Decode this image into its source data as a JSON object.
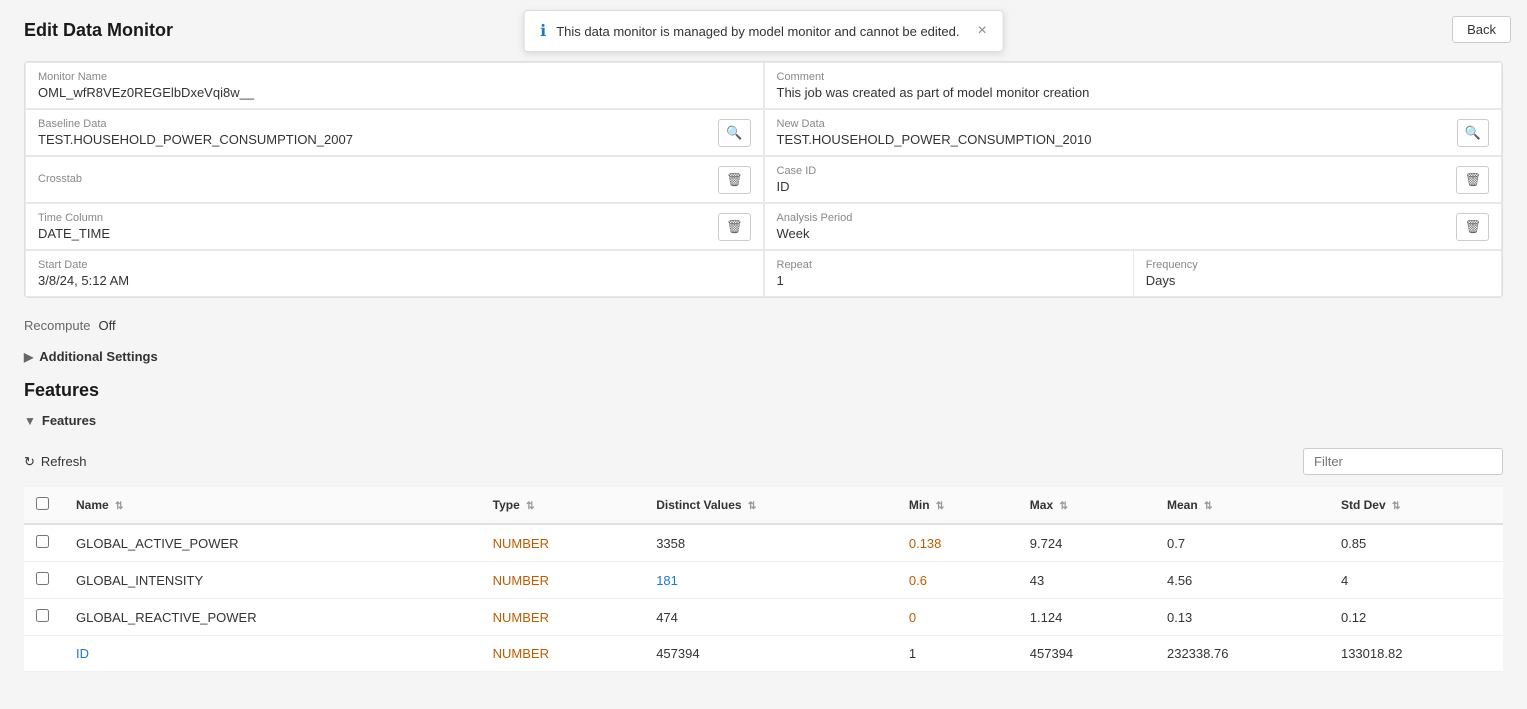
{
  "page": {
    "title": "Edit Data Monitor",
    "back_button": "Back"
  },
  "toast": {
    "message": "This data monitor is managed by model monitor and cannot be edited.",
    "icon": "ℹ",
    "close": "×"
  },
  "form": {
    "monitor_name_label": "Monitor Name",
    "monitor_name_value": "OML_wfR8VEz0REGElbDxeVqi8w__",
    "comment_label": "Comment",
    "comment_value": "This job was created as part of model monitor creation",
    "baseline_data_label": "Baseline Data",
    "baseline_data_value": "TEST.HOUSEHOLD_POWER_CONSUMPTION_2007",
    "new_data_label": "New Data",
    "new_data_value": "TEST.HOUSEHOLD_POWER_CONSUMPTION_2010",
    "crosstab_label": "Crosstab",
    "crosstab_value": "",
    "case_id_label": "Case ID",
    "case_id_value": "ID",
    "time_column_label": "Time Column",
    "time_column_value": "DATE_TIME",
    "analysis_period_label": "Analysis Period",
    "analysis_period_value": "Week",
    "start_date_label": "Start Date",
    "start_date_value": "3/8/24, 5:12 AM",
    "repeat_label": "Repeat",
    "repeat_value": "1",
    "frequency_label": "Frequency",
    "frequency_value": "Days",
    "recompute_label": "Recompute",
    "recompute_value": "Off"
  },
  "additional_settings": {
    "label": "Additional Settings"
  },
  "features_section": {
    "title": "Features",
    "collapsible_label": "Features"
  },
  "table": {
    "refresh_label": "Refresh",
    "filter_placeholder": "Filter",
    "columns": [
      {
        "label": "Name",
        "key": "name"
      },
      {
        "label": "Type",
        "key": "type"
      },
      {
        "label": "Distinct Values",
        "key": "distinct_values"
      },
      {
        "label": "Min",
        "key": "min"
      },
      {
        "label": "Max",
        "key": "max"
      },
      {
        "label": "Mean",
        "key": "mean"
      },
      {
        "label": "Std Dev",
        "key": "std_dev"
      }
    ],
    "rows": [
      {
        "name": "GLOBAL_ACTIVE_POWER",
        "type": "NUMBER",
        "distinct_values": "3358",
        "min": "0.138",
        "max": "9.724",
        "mean": "0.7",
        "std_dev": "0.85",
        "min_link": true,
        "distinct_link": false
      },
      {
        "name": "GLOBAL_INTENSITY",
        "type": "NUMBER",
        "distinct_values": "181",
        "min": "0.6",
        "max": "43",
        "mean": "4.56",
        "std_dev": "4",
        "min_link": true,
        "distinct_link": true
      },
      {
        "name": "GLOBAL_REACTIVE_POWER",
        "type": "NUMBER",
        "distinct_values": "474",
        "min": "0",
        "max": "1.124",
        "mean": "0.13",
        "std_dev": "0.12",
        "min_link": true,
        "distinct_link": false
      },
      {
        "name": "ID",
        "type": "NUMBER",
        "distinct_values": "457394",
        "min": "1",
        "max": "457394",
        "mean": "232338.76",
        "std_dev": "133018.82",
        "min_link": false,
        "distinct_link": false
      }
    ]
  }
}
